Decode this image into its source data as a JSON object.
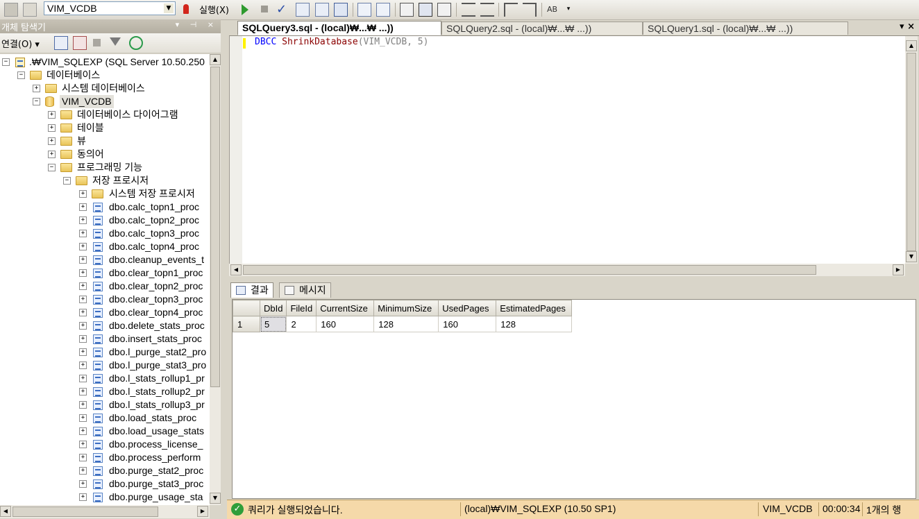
{
  "toolbar": {
    "database_selected": "VIM_VCDB",
    "execute_label": "실행(X)"
  },
  "object_explorer": {
    "title": "개체 탐색기",
    "title_buttons": "▾ ⊣ ×",
    "connect_label": "연결(O) ▾",
    "server_node": ".₩VIM_SQLEXP (SQL Server 10.50.250",
    "databases_node": "데이터베이스",
    "system_databases_node": "시스템 데이터베이스",
    "db_node": "VIM_VCDB",
    "db_children": [
      "데이터베이스 다이어그램",
      "테이블",
      "뷰",
      "동의어",
      "프로그래밍 기능"
    ],
    "stored_procedures_node": "저장 프로시저",
    "system_stored_procedures_node": "시스템 저장 프로시저",
    "procedures": [
      "dbo.calc_topn1_proc",
      "dbo.calc_topn2_proc",
      "dbo.calc_topn3_proc",
      "dbo.calc_topn4_proc",
      "dbo.cleanup_events_t",
      "dbo.clear_topn1_proc",
      "dbo.clear_topn2_proc",
      "dbo.clear_topn3_proc",
      "dbo.clear_topn4_proc",
      "dbo.delete_stats_proc",
      "dbo.insert_stats_proc",
      "dbo.l_purge_stat2_pro",
      "dbo.l_purge_stat3_pro",
      "dbo.l_stats_rollup1_pr",
      "dbo.l_stats_rollup2_pr",
      "dbo.l_stats_rollup3_pr",
      "dbo.load_stats_proc",
      "dbo.load_usage_stats",
      "dbo.process_license_",
      "dbo.process_perform",
      "dbo.purge_stat2_proc",
      "dbo.purge_stat3_proc",
      "dbo.purge_usage_sta"
    ]
  },
  "editor": {
    "tabs": [
      "SQLQuery3.sql - (local)₩...₩    ...))",
      "SQLQuery2.sql - (local)₩...₩    ...))",
      "SQLQuery1.sql - (local)₩...₩    ...))"
    ],
    "tab_controls": "▾ ×",
    "sql": {
      "keyword": "DBCC",
      "function": "ShrinkDatabase",
      "args": "(VIM_VCDB, 5)"
    }
  },
  "results": {
    "tabs": [
      "결과",
      "메시지"
    ],
    "columns": [
      "DbId",
      "FileId",
      "CurrentSize",
      "MinimumSize",
      "UsedPages",
      "EstimatedPages"
    ],
    "rows": [
      {
        "rownum": "1",
        "cells": [
          "5",
          "2",
          "160",
          "128",
          "160",
          "128"
        ]
      }
    ]
  },
  "status": {
    "message": "쿼리가 실행되었습니다.",
    "server": "(local)₩VIM_SQLEXP (10.50 SP1)",
    "database": "VIM_VCDB",
    "elapsed": "00:00:34",
    "rows": "1개의 행"
  }
}
